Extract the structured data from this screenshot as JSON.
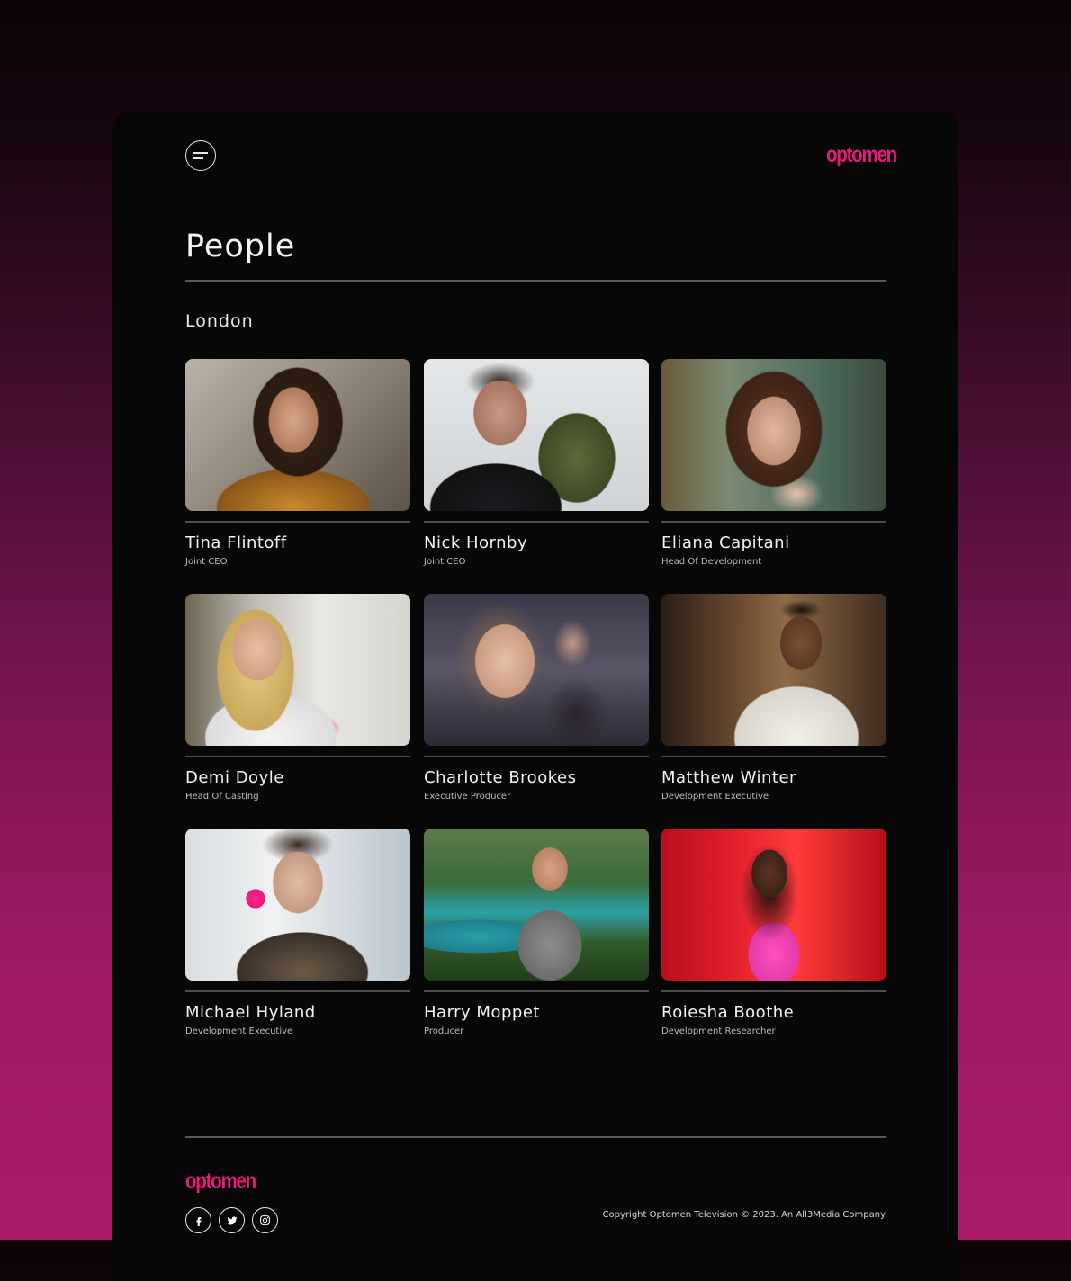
{
  "header": {
    "menu_icon": "hamburger-menu-icon",
    "logo": "optomen"
  },
  "page": {
    "title": "People"
  },
  "section": {
    "title": "London"
  },
  "people": [
    {
      "name": "Tina Flintoff",
      "role": "Joint CEO"
    },
    {
      "name": "Nick Hornby",
      "role": "Joint CEO"
    },
    {
      "name": "Eliana Capitani",
      "role": "Head Of Development"
    },
    {
      "name": "Demi Doyle",
      "role": "Head Of Casting"
    },
    {
      "name": "Charlotte Brookes",
      "role": "Executive Producer"
    },
    {
      "name": "Matthew Winter",
      "role": "Development Executive"
    },
    {
      "name": "Michael Hyland",
      "role": "Development Executive"
    },
    {
      "name": "Harry Moppet",
      "role": "Producer"
    },
    {
      "name": "Roiesha Boothe",
      "role": "Development Researcher"
    }
  ],
  "footer": {
    "logo": "optomen",
    "socials": [
      "facebook-icon",
      "twitter-icon",
      "instagram-icon"
    ],
    "copyright": "Copyright Optomen Television © 2023. An All3Media Company"
  },
  "colors": {
    "accent": "#e61b7a",
    "card_background": "#070707",
    "page_gradient_end": "#a91b68"
  }
}
